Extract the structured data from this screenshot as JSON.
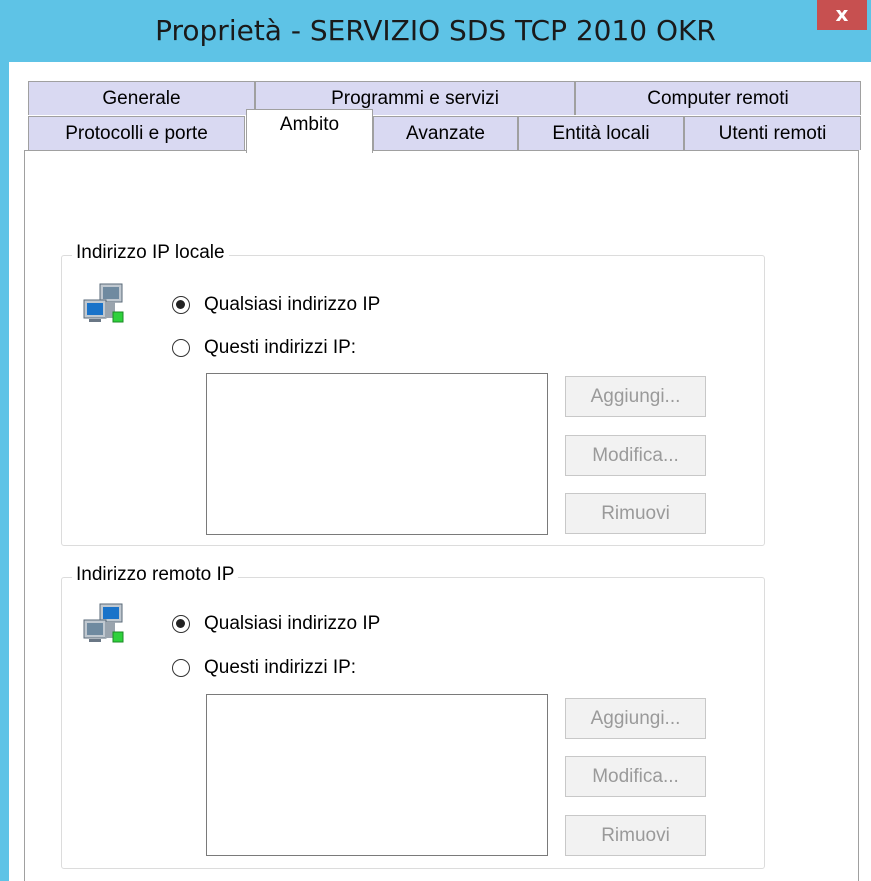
{
  "window": {
    "title": "Proprietà - SERVIZIO SDS TCP 2010 OKR",
    "close_label": "x"
  },
  "tabs": {
    "row1": [
      "Generale",
      "Programmi e servizi",
      "Computer remoti"
    ],
    "row2": [
      "Protocolli e porte",
      "Ambito",
      "Avanzate",
      "Entità locali",
      "Utenti remoti"
    ],
    "active": "Ambito"
  },
  "local_ip": {
    "group_label": "Indirizzo IP locale",
    "option_any": "Qualsiasi indirizzo IP",
    "option_these": "Questi indirizzi IP:",
    "selected": "any",
    "add_label": "Aggiungi...",
    "edit_label": "Modifica...",
    "remove_label": "Rimuovi",
    "icon": "network-computers-icon"
  },
  "remote_ip": {
    "group_label": "Indirizzo remoto IP",
    "option_any": "Qualsiasi indirizzo IP",
    "option_these": "Questi indirizzi IP:",
    "selected": "any",
    "add_label": "Aggiungi...",
    "edit_label": "Modifica...",
    "remove_label": "Rimuovi",
    "icon": "network-computers-icon"
  },
  "colors": {
    "titlebar": "#5ec3e6",
    "close_button": "#c75050",
    "tab_inactive": "#d9d9f2"
  }
}
